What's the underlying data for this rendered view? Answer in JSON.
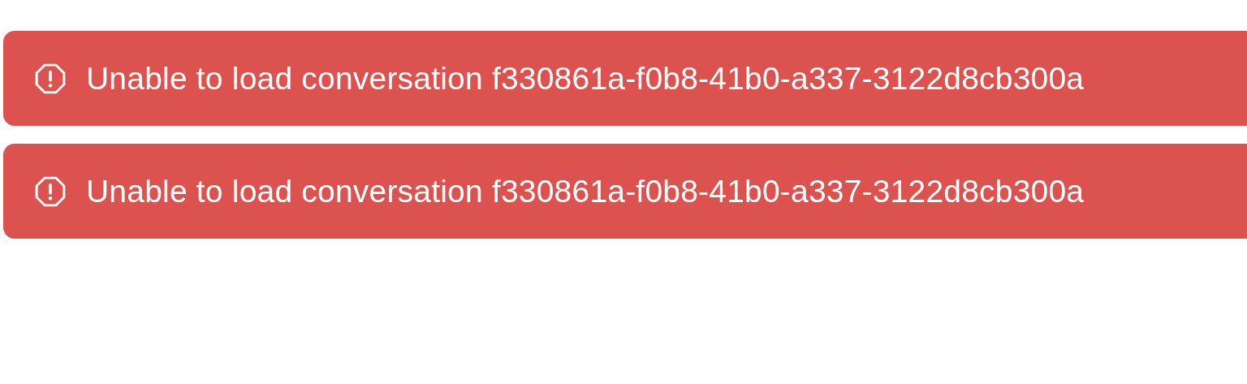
{
  "alerts": [
    {
      "kind": "error",
      "message": "Unable to load conversation f330861a-f0b8-41b0-a337-3122d8cb300a"
    },
    {
      "kind": "error",
      "message": "Unable to load conversation f330861a-f0b8-41b0-a337-3122d8cb300a"
    }
  ]
}
